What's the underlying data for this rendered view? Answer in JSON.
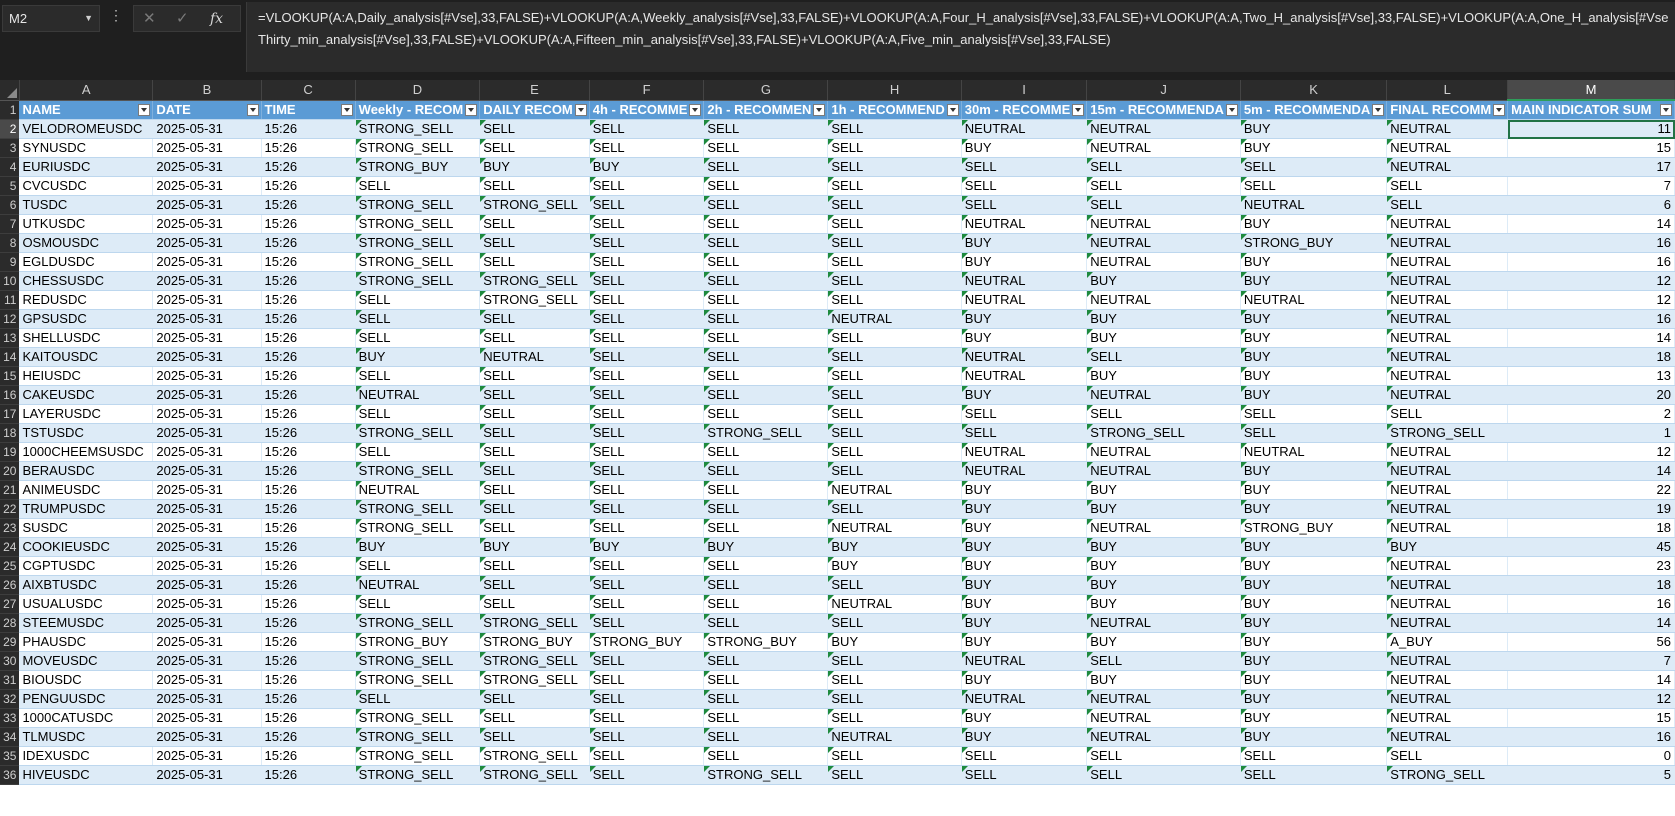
{
  "name_box": "M2",
  "formula": {
    "line1": "=VLOOKUP(A:A,Daily_analysis[#Vse],33,FALSE)+VLOOKUP(A:A,Weekly_analysis[#Vse],33,FALSE)+VLOOKUP(A:A,Four_H_analysis[#Vse],33,FALSE)+VLOOKUP(A:A,Two_H_analysis[#Vse],33,FALSE)+VLOOKUP(A:A,One_H_analysis[#Vse",
    "line2": "Thirty_min_analysis[#Vse],33,FALSE)+VLOOKUP(A:A,Fifteen_min_analysis[#Vse],33,FALSE)+VLOOKUP(A:A,Five_min_analysis[#Vse],33,FALSE)"
  },
  "columns": [
    "A",
    "B",
    "C",
    "D",
    "E",
    "F",
    "G",
    "H",
    "I",
    "J",
    "K",
    "L",
    "M"
  ],
  "headers": [
    "NAME",
    "DATE",
    "TIME",
    "Weekly - RECOM",
    "DAILY RECOM",
    "4h - RECOMME",
    "2h - RECOMMEN",
    "1h - RECOMMEND",
    "30m - RECOMME",
    "15m - RECOMMENDA",
    "5m - RECOMMENDA",
    "FINAL RECOMM",
    "MAIN INDICATOR SUM"
  ],
  "rows": [
    [
      "VELODROMEUSDC",
      "2025-05-31",
      "15:26",
      "STRONG_SELL",
      "SELL",
      "SELL",
      "SELL",
      "SELL",
      "NEUTRAL",
      "NEUTRAL",
      "BUY",
      "NEUTRAL",
      "11"
    ],
    [
      "SYNUSDC",
      "2025-05-31",
      "15:26",
      "STRONG_SELL",
      "SELL",
      "SELL",
      "SELL",
      "SELL",
      "BUY",
      "NEUTRAL",
      "BUY",
      "NEUTRAL",
      "15"
    ],
    [
      "EURIUSDC",
      "2025-05-31",
      "15:26",
      "STRONG_BUY",
      "BUY",
      "BUY",
      "SELL",
      "SELL",
      "SELL",
      "SELL",
      "SELL",
      "NEUTRAL",
      "17"
    ],
    [
      "CVCUSDC",
      "2025-05-31",
      "15:26",
      "SELL",
      "SELL",
      "SELL",
      "SELL",
      "SELL",
      "SELL",
      "SELL",
      "SELL",
      "SELL",
      "7"
    ],
    [
      "TUSDC",
      "2025-05-31",
      "15:26",
      "STRONG_SELL",
      "STRONG_SELL",
      "SELL",
      "SELL",
      "SELL",
      "SELL",
      "SELL",
      "NEUTRAL",
      "SELL",
      "6"
    ],
    [
      "UTKUSDC",
      "2025-05-31",
      "15:26",
      "STRONG_SELL",
      "SELL",
      "SELL",
      "SELL",
      "SELL",
      "NEUTRAL",
      "NEUTRAL",
      "BUY",
      "NEUTRAL",
      "14"
    ],
    [
      "OSMOUSDC",
      "2025-05-31",
      "15:26",
      "STRONG_SELL",
      "SELL",
      "SELL",
      "SELL",
      "SELL",
      "BUY",
      "NEUTRAL",
      "STRONG_BUY",
      "NEUTRAL",
      "16"
    ],
    [
      "EGLDUSDC",
      "2025-05-31",
      "15:26",
      "STRONG_SELL",
      "SELL",
      "SELL",
      "SELL",
      "SELL",
      "BUY",
      "NEUTRAL",
      "BUY",
      "NEUTRAL",
      "16"
    ],
    [
      "CHESSUSDC",
      "2025-05-31",
      "15:26",
      "STRONG_SELL",
      "STRONG_SELL",
      "SELL",
      "SELL",
      "SELL",
      "NEUTRAL",
      "BUY",
      "BUY",
      "NEUTRAL",
      "12"
    ],
    [
      "REDUSDC",
      "2025-05-31",
      "15:26",
      "SELL",
      "STRONG_SELL",
      "SELL",
      "SELL",
      "SELL",
      "NEUTRAL",
      "NEUTRAL",
      "NEUTRAL",
      "NEUTRAL",
      "12"
    ],
    [
      "GPSUSDC",
      "2025-05-31",
      "15:26",
      "SELL",
      "SELL",
      "SELL",
      "SELL",
      "NEUTRAL",
      "BUY",
      "BUY",
      "BUY",
      "NEUTRAL",
      "16"
    ],
    [
      "SHELLUSDC",
      "2025-05-31",
      "15:26",
      "SELL",
      "SELL",
      "SELL",
      "SELL",
      "SELL",
      "BUY",
      "BUY",
      "BUY",
      "NEUTRAL",
      "14"
    ],
    [
      "KAITOUSDC",
      "2025-05-31",
      "15:26",
      "BUY",
      "NEUTRAL",
      "SELL",
      "SELL",
      "SELL",
      "NEUTRAL",
      "SELL",
      "BUY",
      "NEUTRAL",
      "18"
    ],
    [
      "HEIUSDC",
      "2025-05-31",
      "15:26",
      "SELL",
      "SELL",
      "SELL",
      "SELL",
      "SELL",
      "NEUTRAL",
      "BUY",
      "BUY",
      "NEUTRAL",
      "13"
    ],
    [
      "CAKEUSDC",
      "2025-05-31",
      "15:26",
      "NEUTRAL",
      "SELL",
      "SELL",
      "SELL",
      "SELL",
      "BUY",
      "NEUTRAL",
      "BUY",
      "NEUTRAL",
      "20"
    ],
    [
      "LAYERUSDC",
      "2025-05-31",
      "15:26",
      "SELL",
      "SELL",
      "SELL",
      "SELL",
      "SELL",
      "SELL",
      "SELL",
      "SELL",
      "SELL",
      "2"
    ],
    [
      "TSTUSDC",
      "2025-05-31",
      "15:26",
      "STRONG_SELL",
      "SELL",
      "SELL",
      "STRONG_SELL",
      "SELL",
      "SELL",
      "STRONG_SELL",
      "SELL",
      "STRONG_SELL",
      "1"
    ],
    [
      "1000CHEEMSUSDC",
      "2025-05-31",
      "15:26",
      "SELL",
      "SELL",
      "SELL",
      "SELL",
      "SELL",
      "NEUTRAL",
      "NEUTRAL",
      "NEUTRAL",
      "NEUTRAL",
      "12"
    ],
    [
      "BERAUSDC",
      "2025-05-31",
      "15:26",
      "STRONG_SELL",
      "SELL",
      "SELL",
      "SELL",
      "SELL",
      "NEUTRAL",
      "NEUTRAL",
      "BUY",
      "NEUTRAL",
      "14"
    ],
    [
      "ANIMEUSDC",
      "2025-05-31",
      "15:26",
      "NEUTRAL",
      "SELL",
      "SELL",
      "SELL",
      "NEUTRAL",
      "BUY",
      "BUY",
      "BUY",
      "NEUTRAL",
      "22"
    ],
    [
      "TRUMPUSDC",
      "2025-05-31",
      "15:26",
      "STRONG_SELL",
      "SELL",
      "SELL",
      "SELL",
      "SELL",
      "BUY",
      "BUY",
      "BUY",
      "NEUTRAL",
      "19"
    ],
    [
      "SUSDC",
      "2025-05-31",
      "15:26",
      "STRONG_SELL",
      "SELL",
      "SELL",
      "SELL",
      "NEUTRAL",
      "BUY",
      "NEUTRAL",
      "STRONG_BUY",
      "NEUTRAL",
      "18"
    ],
    [
      "COOKIEUSDC",
      "2025-05-31",
      "15:26",
      "BUY",
      "BUY",
      "BUY",
      "BUY",
      "BUY",
      "BUY",
      "BUY",
      "BUY",
      "BUY",
      "45"
    ],
    [
      "CGPTUSDC",
      "2025-05-31",
      "15:26",
      "SELL",
      "SELL",
      "SELL",
      "SELL",
      "BUY",
      "BUY",
      "BUY",
      "BUY",
      "NEUTRAL",
      "23"
    ],
    [
      "AIXBTUSDC",
      "2025-05-31",
      "15:26",
      "NEUTRAL",
      "SELL",
      "SELL",
      "SELL",
      "SELL",
      "BUY",
      "BUY",
      "BUY",
      "NEUTRAL",
      "18"
    ],
    [
      "USUALUSDC",
      "2025-05-31",
      "15:26",
      "SELL",
      "SELL",
      "SELL",
      "SELL",
      "NEUTRAL",
      "BUY",
      "BUY",
      "BUY",
      "NEUTRAL",
      "16"
    ],
    [
      "STEEMUSDC",
      "2025-05-31",
      "15:26",
      "STRONG_SELL",
      "STRONG_SELL",
      "SELL",
      "SELL",
      "SELL",
      "BUY",
      "NEUTRAL",
      "BUY",
      "NEUTRAL",
      "14"
    ],
    [
      "PHAUSDC",
      "2025-05-31",
      "15:26",
      "STRONG_BUY",
      "STRONG_BUY",
      "STRONG_BUY",
      "STRONG_BUY",
      "BUY",
      "BUY",
      "BUY",
      "BUY",
      "A_BUY",
      "56"
    ],
    [
      "MOVEUSDC",
      "2025-05-31",
      "15:26",
      "STRONG_SELL",
      "STRONG_SELL",
      "SELL",
      "SELL",
      "SELL",
      "NEUTRAL",
      "SELL",
      "BUY",
      "NEUTRAL",
      "7"
    ],
    [
      "BIOUSDC",
      "2025-05-31",
      "15:26",
      "STRONG_SELL",
      "STRONG_SELL",
      "SELL",
      "SELL",
      "SELL",
      "BUY",
      "BUY",
      "BUY",
      "NEUTRAL",
      "14"
    ],
    [
      "PENGUUSDC",
      "2025-05-31",
      "15:26",
      "SELL",
      "SELL",
      "SELL",
      "SELL",
      "SELL",
      "NEUTRAL",
      "NEUTRAL",
      "BUY",
      "NEUTRAL",
      "12"
    ],
    [
      "1000CATUSDC",
      "2025-05-31",
      "15:26",
      "STRONG_SELL",
      "SELL",
      "SELL",
      "SELL",
      "SELL",
      "BUY",
      "NEUTRAL",
      "BUY",
      "NEUTRAL",
      "15"
    ],
    [
      "TLMUSDC",
      "2025-05-31",
      "15:26",
      "STRONG_SELL",
      "SELL",
      "SELL",
      "SELL",
      "NEUTRAL",
      "BUY",
      "NEUTRAL",
      "BUY",
      "NEUTRAL",
      "16"
    ],
    [
      "IDEXUSDC",
      "2025-05-31",
      "15:26",
      "STRONG_SELL",
      "STRONG_SELL",
      "SELL",
      "SELL",
      "SELL",
      "SELL",
      "SELL",
      "SELL",
      "SELL",
      "0"
    ],
    [
      "HIVEUSDC",
      "2025-05-31",
      "15:26",
      "STRONG_SELL",
      "STRONG_SELL",
      "SELL",
      "STRONG_SELL",
      "SELL",
      "SELL",
      "SELL",
      "SELL",
      "STRONG_SELL",
      "5"
    ]
  ],
  "active_cell": "M2",
  "icons": {
    "cancel": "close-icon",
    "enter": "check-icon",
    "function": "fx-icon"
  },
  "colors": {
    "header_fill": "#5b9bd5",
    "band_fill": "#ddebf7",
    "selection": "#217346"
  }
}
